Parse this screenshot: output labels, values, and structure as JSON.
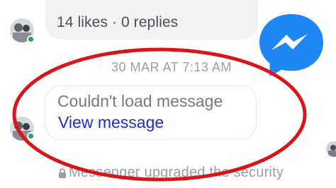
{
  "reactions_line": {
    "text": "14 likes · 0 replies"
  },
  "timestamp": "30 MAR AT 7:13 AM",
  "failed_message": {
    "status_text": "Couldn't load message",
    "action_link": "View message"
  },
  "security_notice": {
    "text": "Messenger upgraded the security"
  },
  "icons": {
    "logo": "messenger-logo-icon",
    "lock": "lock-icon",
    "presence": "online-status-dot"
  },
  "colors": {
    "link": "#1a2ecc",
    "muted_text": "#76797e",
    "online": "#31a24c",
    "messenger_blue": "#1e86f5",
    "annotation_red": "#d7161c"
  }
}
